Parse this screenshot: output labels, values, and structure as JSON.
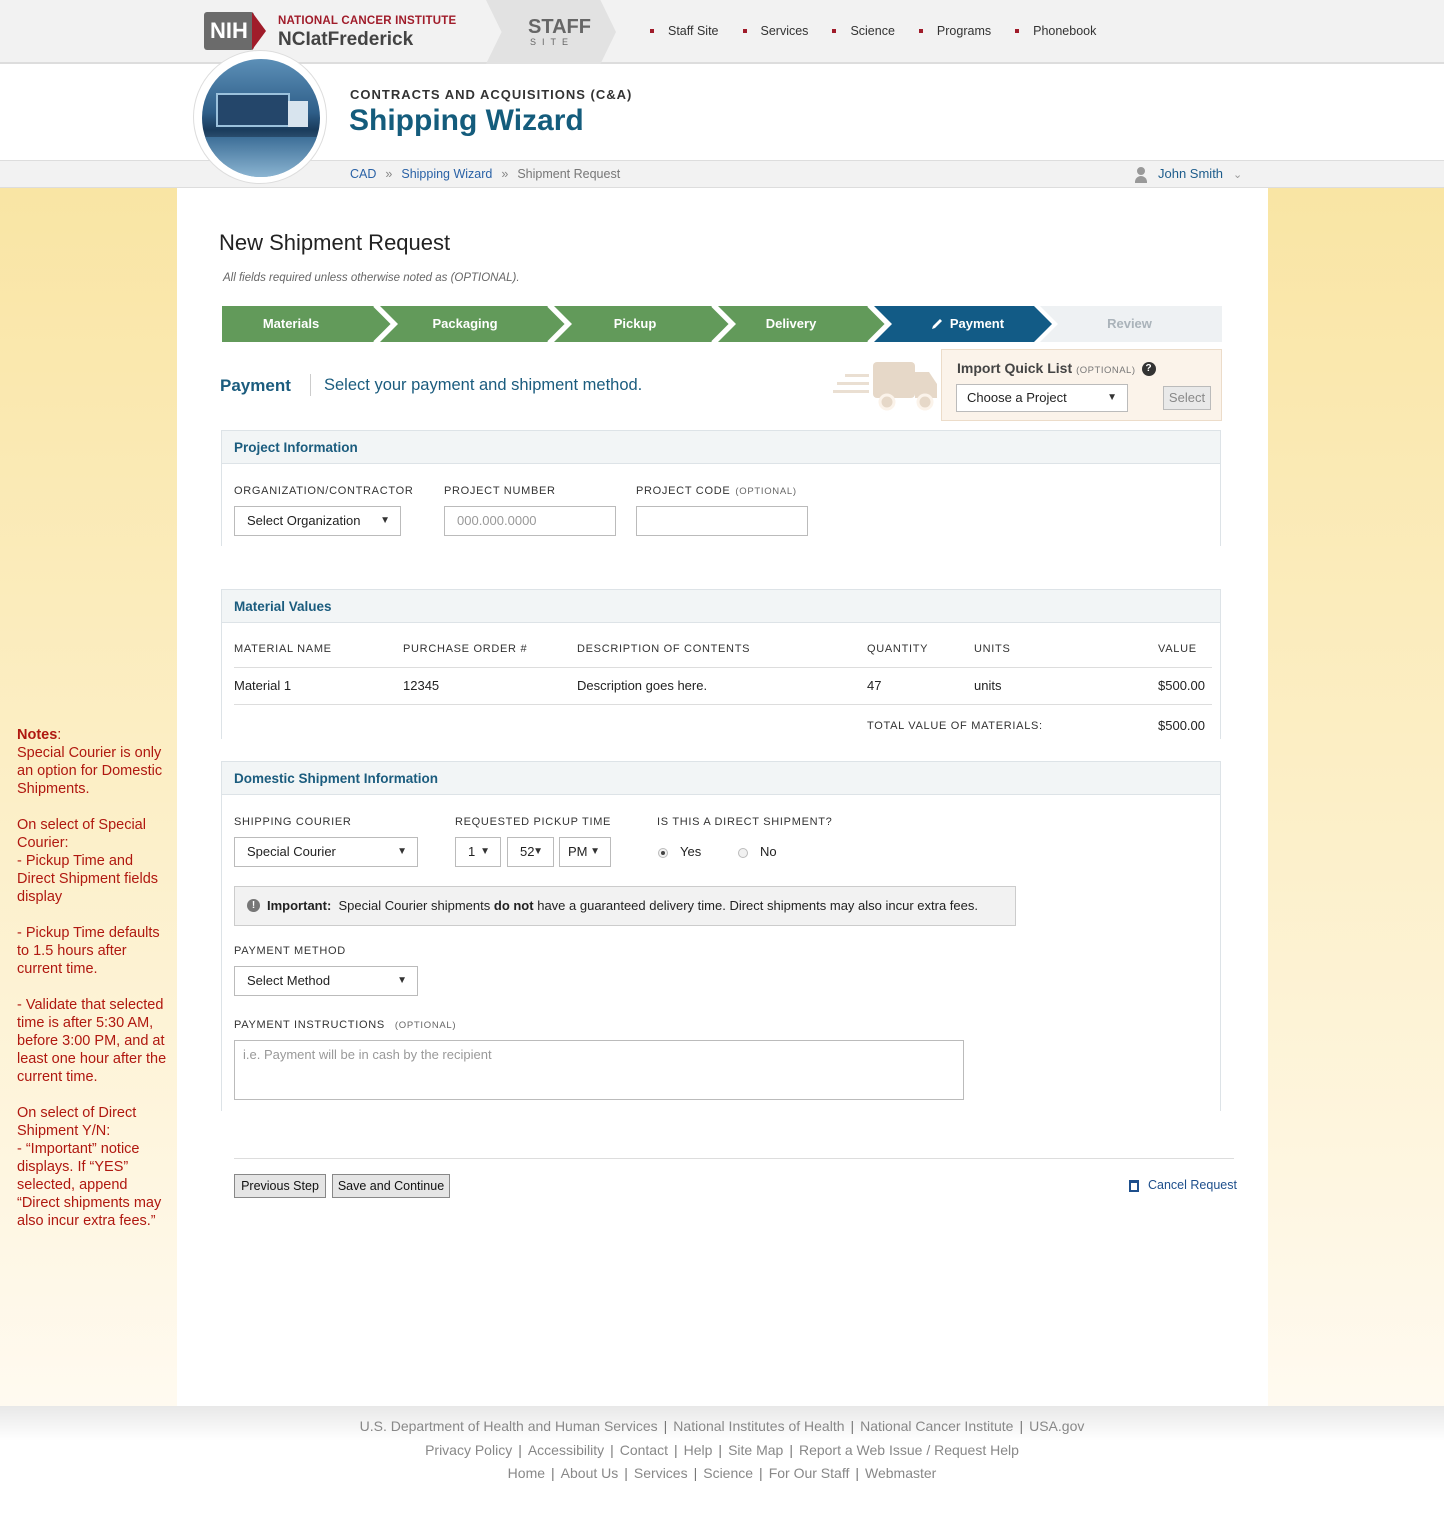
{
  "header": {
    "nih_logo": "NIH",
    "institute": "NATIONAL CANCER INSTITUTE",
    "campus": "NCIatFrederick",
    "staff_title": "STAFF",
    "staff_sub": "SITE",
    "nav": [
      "Staff Site",
      "Services",
      "Science",
      "Programs",
      "Phonebook"
    ],
    "department": "CONTRACTS AND ACQUISITIONS (C&A)",
    "app_title": "Shipping Wizard"
  },
  "breadcrumb": {
    "items": [
      "CAD",
      "Shipping Wizard",
      "Shipment Request"
    ],
    "separator": "»"
  },
  "user": {
    "name": "John Smith"
  },
  "page": {
    "title": "New Shipment Request",
    "subtitle": "All fields required unless otherwise noted as (OPTIONAL)."
  },
  "steps": [
    {
      "label": "Materials",
      "state": "done"
    },
    {
      "label": "Packaging",
      "state": "done"
    },
    {
      "label": "Pickup",
      "state": "done"
    },
    {
      "label": "Delivery",
      "state": "done"
    },
    {
      "label": "Payment",
      "state": "active",
      "icon": "pencil-icon"
    },
    {
      "label": "Review",
      "state": "todo"
    }
  ],
  "section": {
    "label": "Payment",
    "description": "Select your payment and shipment method."
  },
  "quick_list": {
    "title": "Import Quick List",
    "optional": "(OPTIONAL)",
    "select_value": "Choose a Project",
    "button": "Select"
  },
  "project_info": {
    "heading": "Project Information",
    "org_label": "ORGANIZATION/CONTRACTOR",
    "org_value": "Select Organization",
    "number_label": "PROJECT NUMBER",
    "number_placeholder": "000.000.0000",
    "code_label": "PROJECT CODE",
    "code_optional": "(OPTIONAL)",
    "code_value": ""
  },
  "material_values": {
    "heading": "Material Values",
    "columns": [
      "MATERIAL NAME",
      "PURCHASE ORDER #",
      "DESCRIPTION OF CONTENTS",
      "QUANTITY",
      "UNITS",
      "VALUE"
    ],
    "rows": [
      {
        "name": "Material 1",
        "po": "12345",
        "description": "Description goes here.",
        "quantity": "47",
        "units": "units",
        "value": "$500.00"
      }
    ],
    "total_label": "TOTAL VALUE OF MATERIALS:",
    "total_value": "$500.00"
  },
  "domestic": {
    "heading": "Domestic Shipment Information",
    "courier_label": "SHIPPING COURIER",
    "courier_value": "Special Courier",
    "pickup_label": "REQUESTED PICKUP TIME",
    "pickup_hour": "1",
    "pickup_minute": "52",
    "pickup_ampm": "PM",
    "direct_label": "IS THIS A DIRECT SHIPMENT?",
    "direct_yes": "Yes",
    "direct_no": "No",
    "direct_selected": "Yes",
    "notice_strong": "Important:",
    "notice_pre": "Special Courier shipments",
    "notice_bold": "do not",
    "notice_post": "have a guaranteed delivery time. Direct shipments may also incur extra fees.",
    "payment_label": "PAYMENT METHOD",
    "payment_value": "Select Method",
    "instructions_label": "PAYMENT INSTRUCTIONS",
    "instructions_optional": "(OPTIONAL)",
    "instructions_placeholder": "i.e. Payment will be in cash by the recipient"
  },
  "actions": {
    "previous": "Previous Step",
    "save": "Save and Continue",
    "cancel": "Cancel Request"
  },
  "notes": {
    "title": "Notes",
    "body": "Special Courier is only an option for Domestic Shipments.\n\nOn select of Special Courier:\n- Pickup Time and Direct Shipment fields display\n\n- Pickup Time defaults to 1.5 hours after current time.\n\n- Validate that selected time is after 5:30 AM, before 3:00 PM, and at least one hour after the current time.\n\nOn select of Direct Shipment Y/N:\n- “Important” notice displays. If “YES” selected, append “Direct shipments may also incur extra fees.”"
  },
  "footer": {
    "row1": [
      "U.S. Department of Health and Human Services",
      "National Institutes of Health",
      "National Cancer Institute",
      "USA.gov"
    ],
    "row2": [
      "Privacy Policy",
      "Accessibility",
      "Contact",
      "Help",
      "Site Map",
      "Report a Web Issue / Request Help"
    ],
    "row3": [
      "Home",
      "About Us",
      "Services",
      "Science",
      "For Our Staff",
      "Webmaster"
    ]
  },
  "colors": {
    "brand_red": "#a01c2a",
    "brand_blue": "#145c7c",
    "step_done": "#629a5a",
    "step_active": "#125b86",
    "notes_red": "#b01810"
  }
}
